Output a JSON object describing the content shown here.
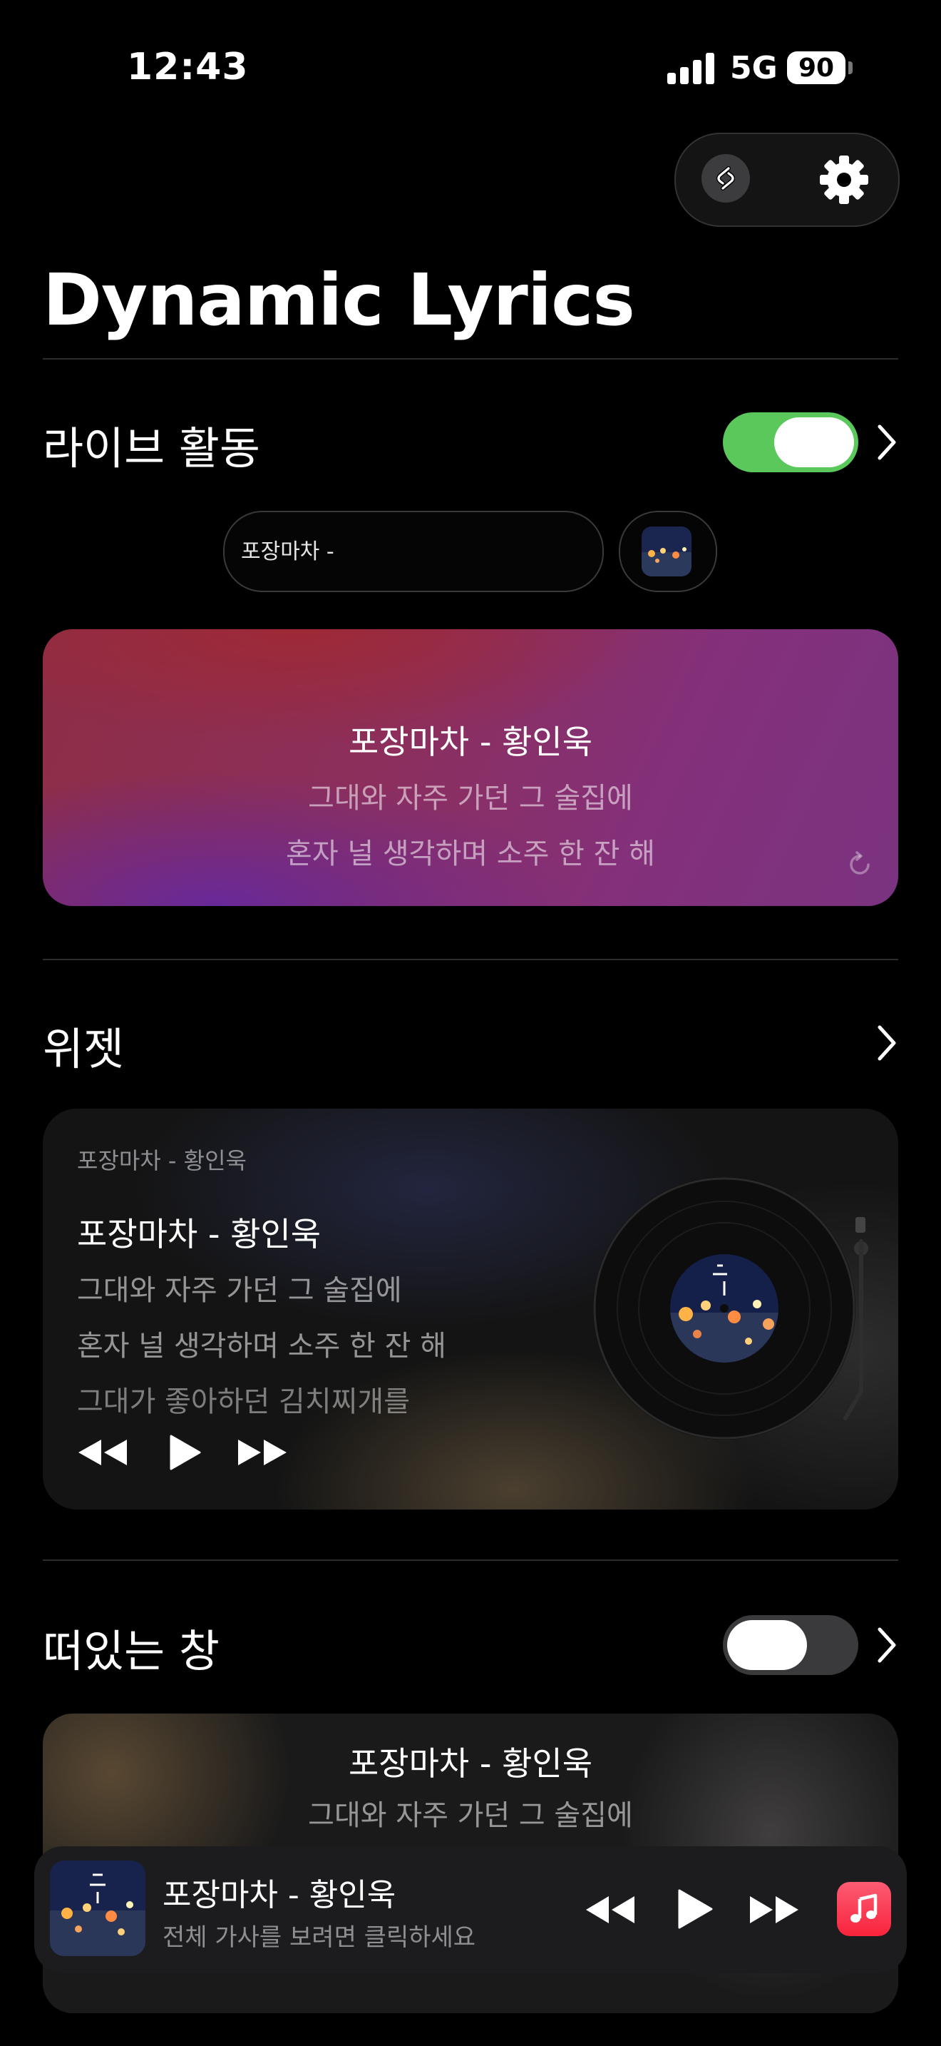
{
  "status_bar": {
    "time": "12:43",
    "network": "5G",
    "battery": "90"
  },
  "header": {
    "title": "Dynamic Lyrics"
  },
  "live_activity": {
    "label": "라이브 활동",
    "toggle_on": true,
    "pill_text": "포장마차 -",
    "card": {
      "title": "포장마차 - 황인욱",
      "line1": "그대와 자주 가던 그 술집에",
      "line2": "혼자 널 생각하며 소주 한 잔 해"
    }
  },
  "widget": {
    "label": "위젯",
    "small_title": "포장마차 - 황인욱",
    "title": "포장마차 - 황인욱",
    "line1": "그대와 자주 가던 그 술집에",
    "line2": "혼자 널 생각하며 소주 한 잔 해",
    "line3": "그대가 좋아하던 김치찌개를"
  },
  "floating_window": {
    "label": "떠있는 창",
    "toggle_on": false,
    "title": "포장마차 - 황인욱",
    "line1": "그대와 자주 가던 그 술집에"
  },
  "mini_player": {
    "title": "포장마차 - 황인욱",
    "subtitle": "전체 가사를 보려면 클릭하세요"
  },
  "colors": {
    "toggle_on": "#5ac85a",
    "toggle_off": "#3a3a3c",
    "music_app": "#fa2d48"
  },
  "icons": [
    "shazam-icon",
    "gear-icon",
    "chevron-right-icon",
    "refresh-icon",
    "rewind-icon",
    "play-icon",
    "fast-forward-icon",
    "music-note-icon"
  ]
}
